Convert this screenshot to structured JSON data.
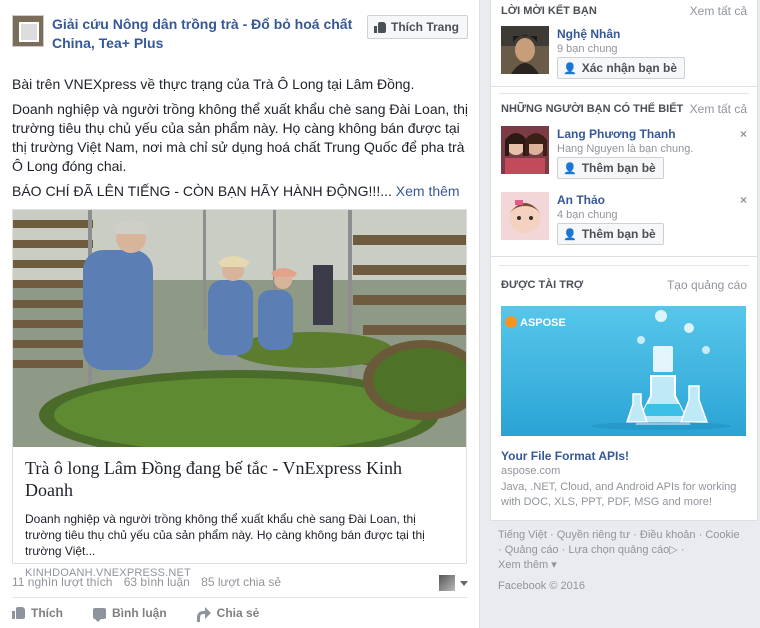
{
  "post": {
    "page_name": "Giải cứu Nông dân trồng trà - Đổ bỏ hoá chất China, Tea+ Plus",
    "like_page_label": "Thích Trang",
    "paragraphs": [
      "Bài trên VNEXpress về thực trạng của Trà Ô Long tại Lâm Đồng.",
      "Doanh nghiệp và người trồng không thể xuất khẩu chè sang Đài Loan, thị trường tiêu thụ chủ yếu của sản phẩm này. Họ càng không bán được tại thị trường Việt Nam, nơi mà chỉ sử dụng hoá chất Trung Quốc để pha trà Ô Long đóng chai."
    ],
    "callout": "BÁO CHÍ ĐÃ LÊN TIẾNG - CÒN BẠN HÃY HÀNH ĐỘNG!!!...",
    "see_more": "Xem thêm",
    "link": {
      "title": "Trà ô long Lâm Đồng đang bế tắc - VnExpress Kinh Doanh",
      "description": "Doanh nghiệp và người trồng không thể xuất khẩu chè sang Đài Loan, thị trường tiêu thụ chủ yếu của sản phẩm này. Họ càng không bán được tại thị trường Việt...",
      "domain": "KINHDOANH.VNEXPRESS.NET"
    },
    "stats": {
      "likes": "11 nghìn lượt thích",
      "comments": "63 bình luận",
      "shares": "85 lượt chia sẻ"
    },
    "actions": {
      "like": "Thích",
      "comment": "Bình luận",
      "share": "Chia sẻ"
    }
  },
  "sidebar": {
    "friend_requests": {
      "title": "LỜI MỜI KẾT BẠN",
      "see_all": "Xem tất cả",
      "items": [
        {
          "name": "Nghệ Nhân",
          "sub": "9 bạn chung",
          "button": "Xác nhận bạn bè"
        }
      ]
    },
    "people_you_may_know": {
      "title": "NHỮNG NGƯỜI BẠN CÓ THỂ BIẾT",
      "see_all": "Xem tất cả",
      "items": [
        {
          "name": "Lang Phương Thanh",
          "sub": "Hang Nguyen là bạn chung.",
          "button": "Thêm bạn bè"
        },
        {
          "name": "An Thảo",
          "sub": "4 bạn chung",
          "button": "Thêm bạn bè"
        }
      ]
    },
    "sponsored": {
      "title": "ĐƯỢC TÀI TRỢ",
      "create_ad": "Tạo quảng cáo",
      "brand": "ASPOSE",
      "ad_title": "Your File Format APIs!",
      "ad_domain": "aspose.com",
      "ad_description": "Java, .NET, Cloud, and Android APIs for working with DOC, XLS, PPT, PDF, MSG and more!"
    },
    "footer": {
      "links": [
        "Tiếng Việt",
        "Quyền riêng tư",
        "Điều khoản",
        "Cookie",
        "Quảng cáo",
        "Lựa chọn quảng cáo",
        "Xem thêm"
      ],
      "copyright": "Facebook © 2016"
    }
  },
  "colors": {
    "link_blue": "#365899",
    "muted": "#90949c",
    "background": "#e9ebee",
    "ad_blue": "#3fb4df"
  }
}
